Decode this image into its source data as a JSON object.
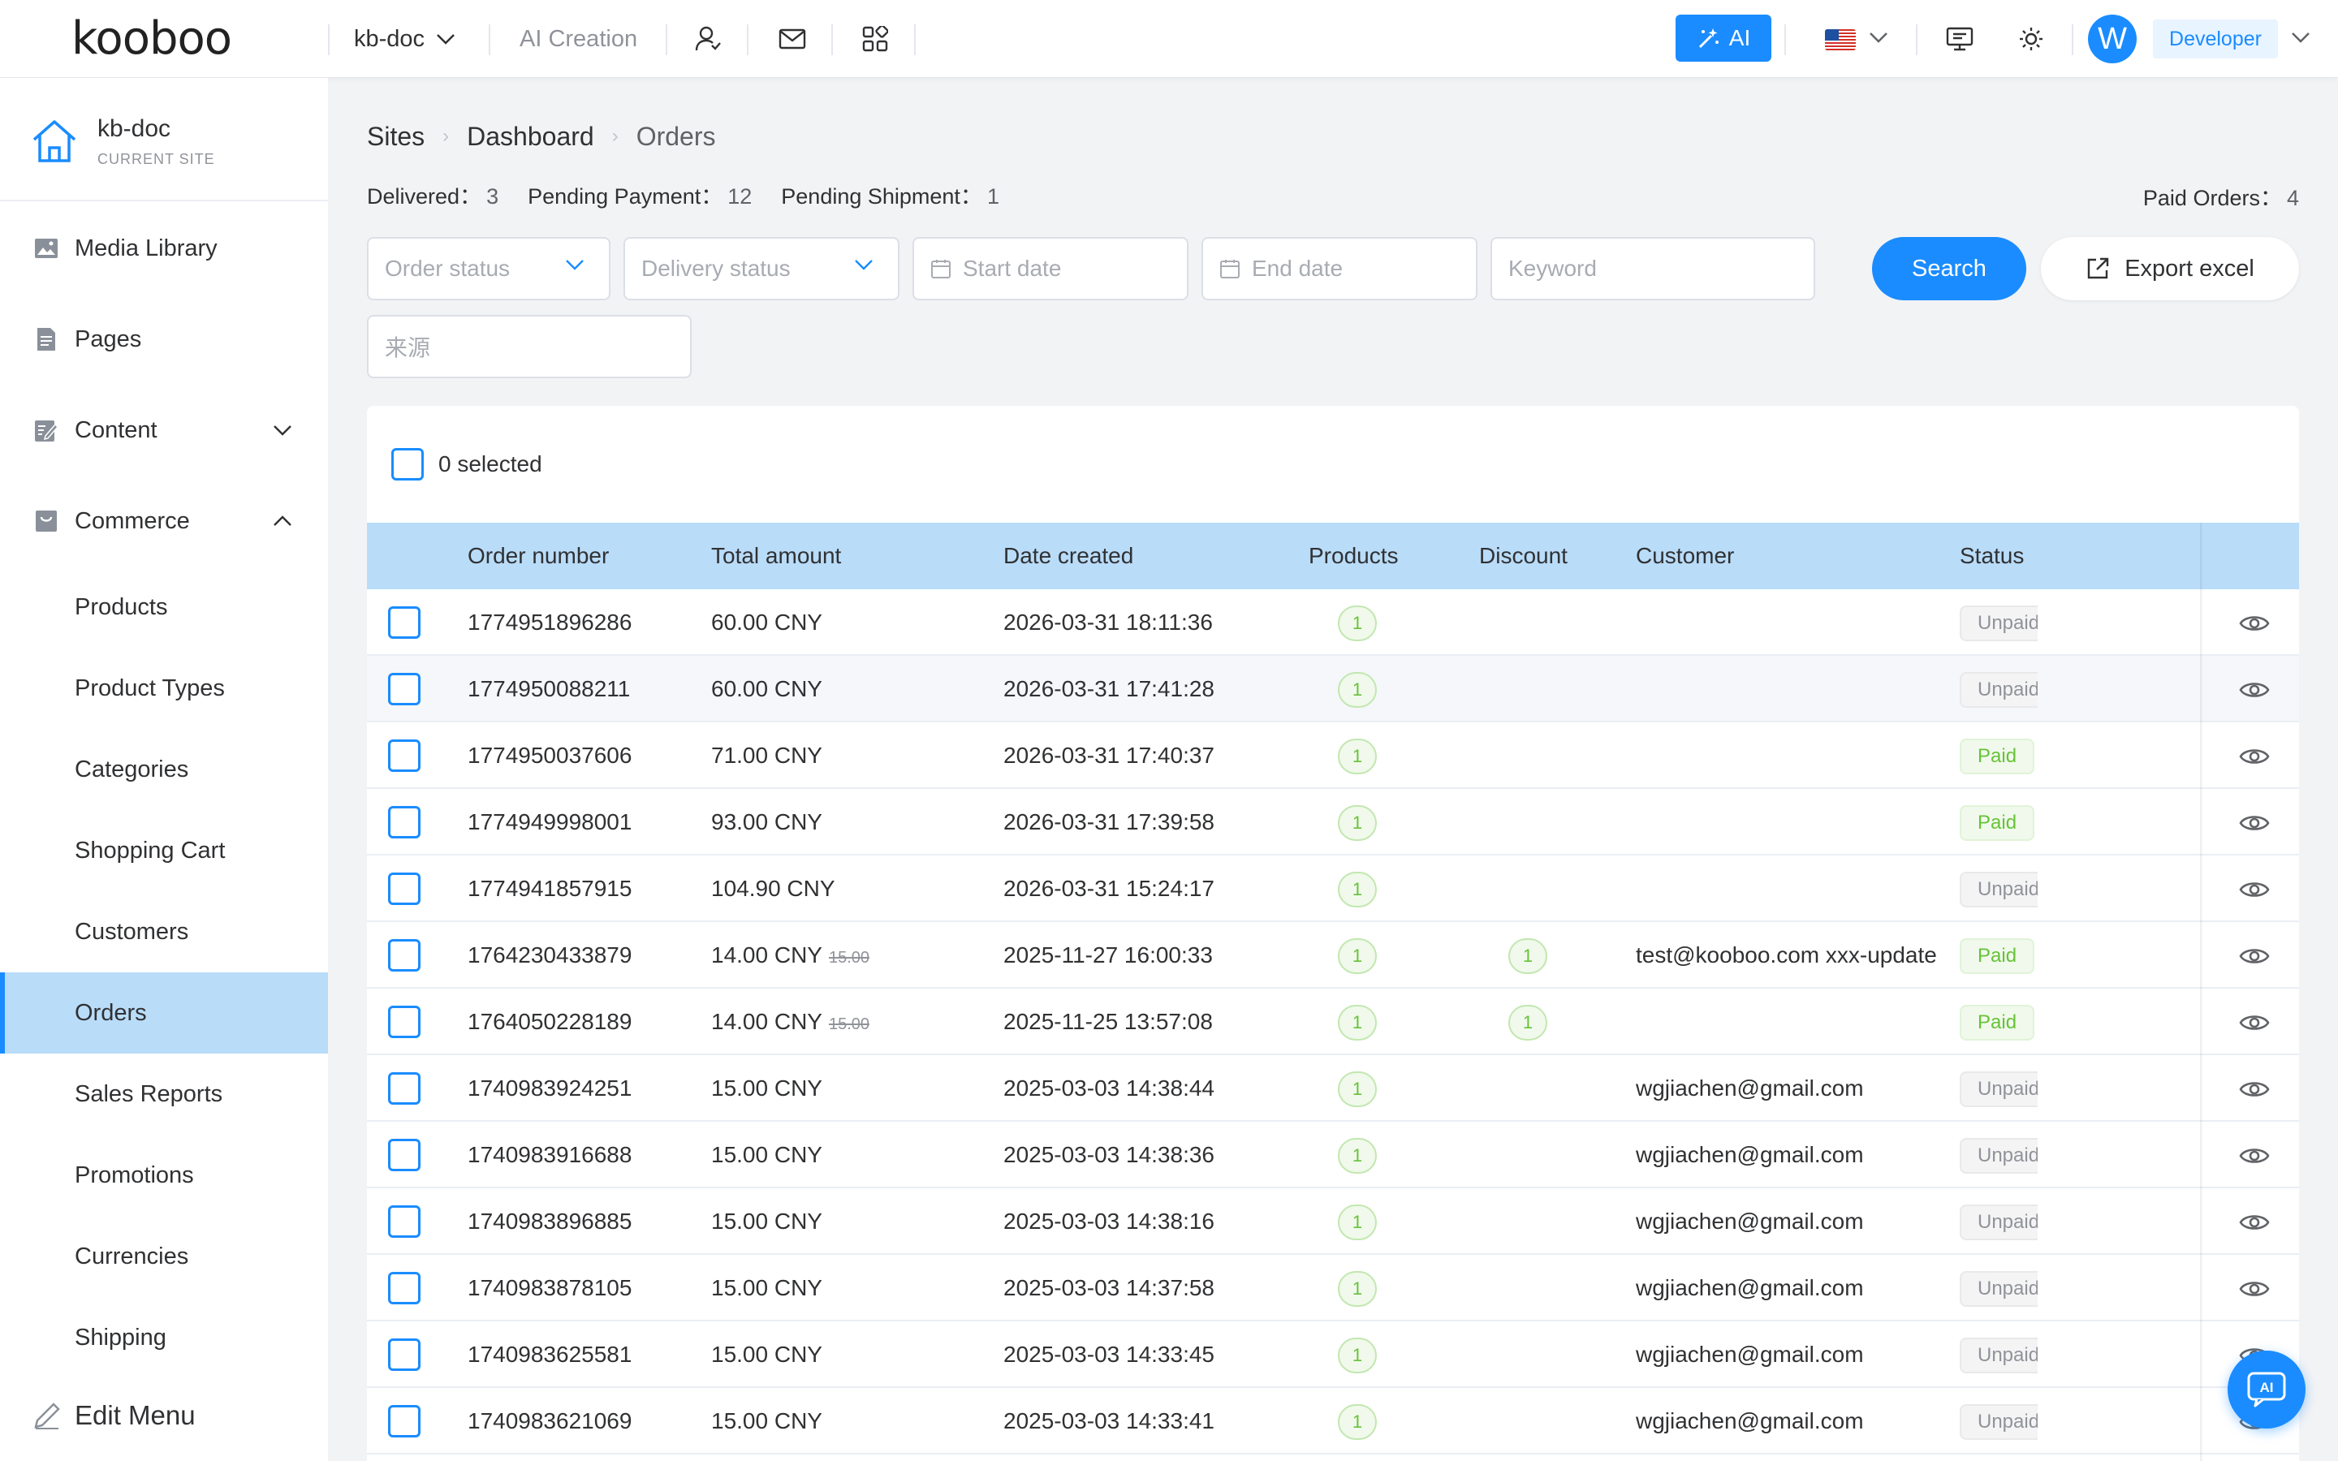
{
  "topbar": {
    "logo": "kooboo",
    "site_selector": "kb-doc",
    "ai_creation": "AI Creation",
    "ai_button": "AI",
    "avatar_letter": "W",
    "role": "Developer",
    "icons": [
      "user-switch-icon",
      "mail-icon",
      "apps-grid-icon",
      "monitor-icon",
      "theme-sun-icon"
    ],
    "language_flag": "us-flag"
  },
  "sidebar": {
    "site_name": "kb-doc",
    "site_subtitle": "CURRENT SITE",
    "items": [
      {
        "label": "Media Library",
        "icon": "image-icon"
      },
      {
        "label": "Pages",
        "icon": "page-icon"
      },
      {
        "label": "Content",
        "icon": "edit-doc-icon",
        "chevron": "down"
      },
      {
        "label": "Commerce",
        "icon": "bag-icon",
        "chevron": "up"
      }
    ],
    "commerce_sub": [
      "Products",
      "Product Types",
      "Categories",
      "Shopping Cart",
      "Customers",
      "Orders",
      "Sales Reports",
      "Promotions",
      "Currencies",
      "Shipping"
    ],
    "active_sub": "Orders",
    "edit_menu": "Edit Menu"
  },
  "breadcrumb": [
    "Sites",
    "Dashboard",
    "Orders"
  ],
  "stats": {
    "delivered_label": "Delivered：",
    "delivered": "3",
    "pending_payment_label": "Pending Payment：",
    "pending_payment": "12",
    "pending_shipment_label": "Pending Shipment：",
    "pending_shipment": "1",
    "paid_orders_label": "Paid Orders：",
    "paid_orders": "4"
  },
  "filters": {
    "order_status": "Order status",
    "delivery_status": "Delivery status",
    "start_date": "Start date",
    "end_date": "End date",
    "keyword": "Keyword",
    "source": "来源",
    "search": "Search",
    "export": "Export excel"
  },
  "table": {
    "selected_text": "0 selected",
    "columns": [
      "Order number",
      "Total amount",
      "Date created",
      "Products",
      "Discount",
      "Customer",
      "Status"
    ],
    "rows": [
      {
        "order": "1774951896286",
        "amount": "60.00 CNY",
        "orig": "",
        "date": "2026-03-31 18:11:36",
        "products": "1",
        "discount": "",
        "customer": "",
        "status": "Unpaid"
      },
      {
        "order": "1774950088211",
        "amount": "60.00 CNY",
        "orig": "",
        "date": "2026-03-31 17:41:28",
        "products": "1",
        "discount": "",
        "customer": "",
        "status": "Unpaid"
      },
      {
        "order": "1774950037606",
        "amount": "71.00 CNY",
        "orig": "",
        "date": "2026-03-31 17:40:37",
        "products": "1",
        "discount": "",
        "customer": "",
        "status": "Paid"
      },
      {
        "order": "1774949998001",
        "amount": "93.00 CNY",
        "orig": "",
        "date": "2026-03-31 17:39:58",
        "products": "1",
        "discount": "",
        "customer": "",
        "status": "Paid"
      },
      {
        "order": "1774941857915",
        "amount": "104.90 CNY",
        "orig": "",
        "date": "2026-03-31 15:24:17",
        "products": "1",
        "discount": "",
        "customer": "",
        "status": "Unpaid"
      },
      {
        "order": "1764230433879",
        "amount": "14.00 CNY",
        "orig": "15.00",
        "date": "2025-11-27 16:00:33",
        "products": "1",
        "discount": "1",
        "customer": "test@kooboo.com xxx-update",
        "status": "Paid"
      },
      {
        "order": "1764050228189",
        "amount": "14.00 CNY",
        "orig": "15.00",
        "date": "2025-11-25 13:57:08",
        "products": "1",
        "discount": "1",
        "customer": "",
        "status": "Paid"
      },
      {
        "order": "1740983924251",
        "amount": "15.00 CNY",
        "orig": "",
        "date": "2025-03-03 14:38:44",
        "products": "1",
        "discount": "",
        "customer": "wgjiachen@gmail.com",
        "status": "Unpaid"
      },
      {
        "order": "1740983916688",
        "amount": "15.00 CNY",
        "orig": "",
        "date": "2025-03-03 14:38:36",
        "products": "1",
        "discount": "",
        "customer": "wgjiachen@gmail.com",
        "status": "Unpaid"
      },
      {
        "order": "1740983896885",
        "amount": "15.00 CNY",
        "orig": "",
        "date": "2025-03-03 14:38:16",
        "products": "1",
        "discount": "",
        "customer": "wgjiachen@gmail.com",
        "status": "Unpaid"
      },
      {
        "order": "1740983878105",
        "amount": "15.00 CNY",
        "orig": "",
        "date": "2025-03-03 14:37:58",
        "products": "1",
        "discount": "",
        "customer": "wgjiachen@gmail.com",
        "status": "Unpaid"
      },
      {
        "order": "1740983625581",
        "amount": "15.00 CNY",
        "orig": "",
        "date": "2025-03-03 14:33:45",
        "products": "1",
        "discount": "",
        "customer": "wgjiachen@gmail.com",
        "status": "Unpaid"
      },
      {
        "order": "1740983621069",
        "amount": "15.00 CNY",
        "orig": "",
        "date": "2025-03-03 14:33:41",
        "products": "1",
        "discount": "",
        "customer": "wgjiachen@gmail.com",
        "status": "Unpaid"
      }
    ]
  },
  "colors": {
    "accent": "#1a8cff",
    "header_row": "#b9dcf9",
    "paid": "#67c23a",
    "unpaid": "#909399"
  }
}
